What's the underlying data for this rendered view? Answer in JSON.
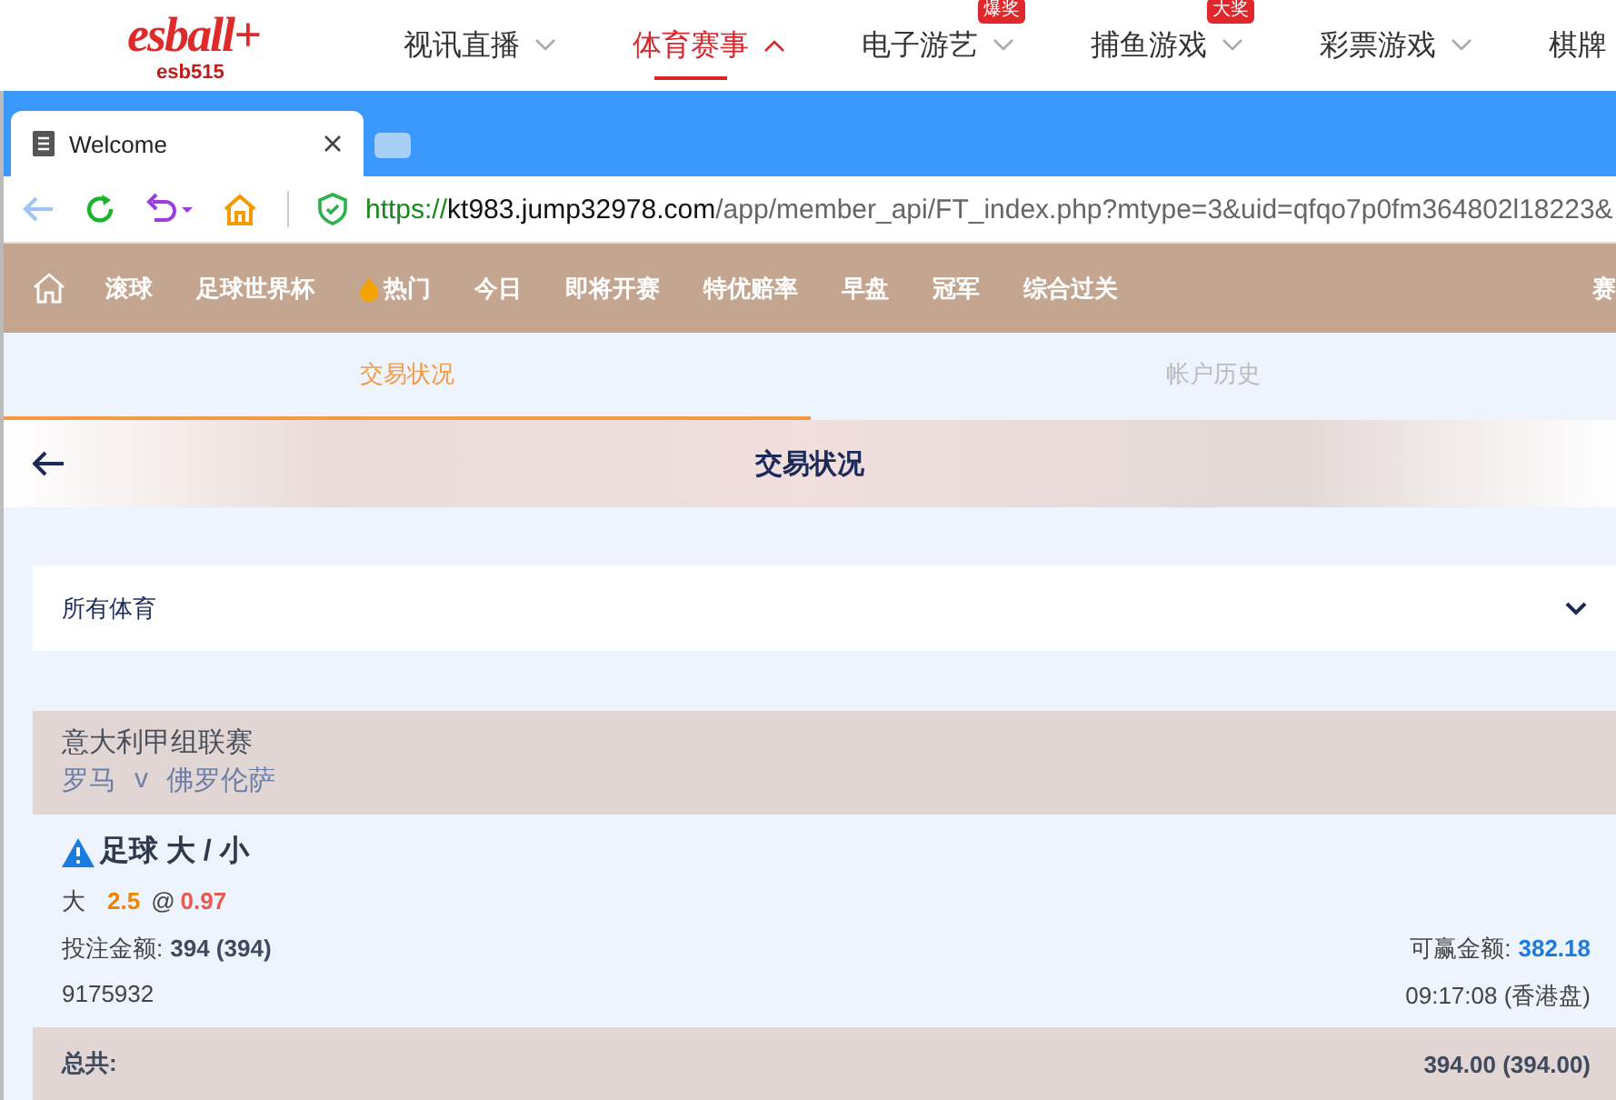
{
  "site_header": {
    "logo": {
      "brand": "esball+",
      "sub": "esb515"
    },
    "nav": [
      {
        "label": "视讯直播",
        "selected": false,
        "expanded": false
      },
      {
        "label": "体育赛事",
        "selected": true,
        "expanded": true
      },
      {
        "label": "电子游艺",
        "selected": false,
        "expanded": false,
        "badge": "爆奖"
      },
      {
        "label": "捕鱼游戏",
        "selected": false,
        "expanded": false,
        "badge": "大奖"
      },
      {
        "label": "彩票游戏",
        "selected": false,
        "expanded": false
      },
      {
        "label": "棋牌",
        "selected": false
      }
    ]
  },
  "browser": {
    "tabs": [
      {
        "title": "Welcome",
        "selected": true
      },
      {
        "selected": false
      }
    ],
    "url": {
      "scheme": "https://",
      "host": "kt983.jump32978.com",
      "path": "/app/member_api/FT_index.php?mtype=3&uid=qfqo7p0fm364802l18223&"
    }
  },
  "sport_nav": [
    {
      "kind": "home"
    },
    {
      "kind": "text",
      "label": "滚球"
    },
    {
      "kind": "text",
      "label": "足球世界杯"
    },
    {
      "kind": "hot",
      "label": "热门"
    },
    {
      "kind": "text",
      "label": "今日"
    },
    {
      "kind": "text",
      "label": "即将开赛"
    },
    {
      "kind": "text",
      "label": "特优赔率"
    },
    {
      "kind": "text",
      "label": "早盘"
    },
    {
      "kind": "text",
      "label": "冠军"
    },
    {
      "kind": "text",
      "label": "综合过关"
    },
    {
      "kind": "edge",
      "label": "赛"
    }
  ],
  "tabs": [
    {
      "label": "交易状况",
      "selected": true
    },
    {
      "label": "帐户历史",
      "selected": false
    }
  ],
  "header": {
    "title": "交易状况"
  },
  "filter": {
    "value": "所有体育"
  },
  "bet": {
    "league": "意大利甲组联赛",
    "home": "罗马",
    "vs": "v",
    "away": "佛罗伦萨",
    "market": "足球 大 / 小",
    "selection": "大",
    "line": "2.5",
    "at": "@",
    "odds": "0.97",
    "stake_label": "投注金额:",
    "stake": "394 (394)",
    "win_label": "可赢金额:",
    "win": "382.18",
    "ticket": "9175932",
    "time": "09:17:08 (香港盘)"
  },
  "total": {
    "label": "总共:",
    "value": "394.00 (394.00)"
  }
}
